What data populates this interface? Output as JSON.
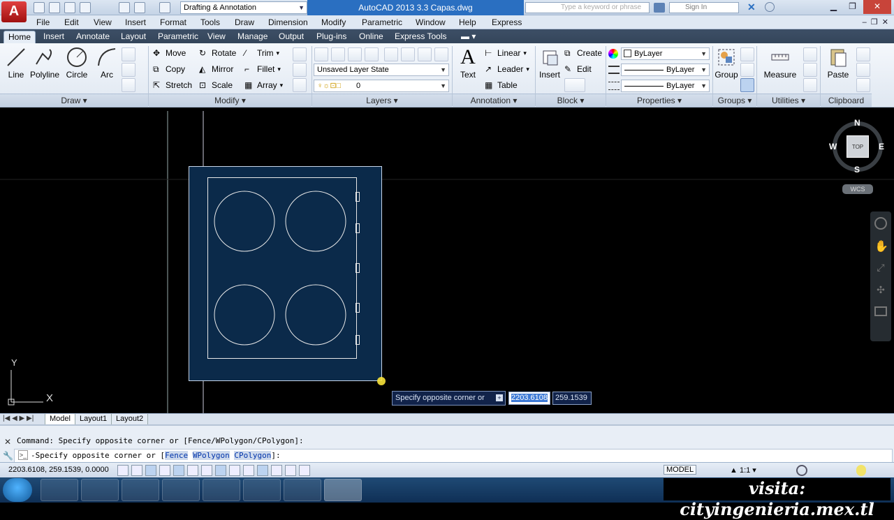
{
  "title_bar": {
    "app_button": "A",
    "workspace": "Drafting & Annotation",
    "window_title": "AutoCAD 2013    3.3 Capas.dwg",
    "search_placeholder": "Type a keyword or phrase",
    "sign_in": "Sign In"
  },
  "menu": [
    "File",
    "Edit",
    "View",
    "Insert",
    "Format",
    "Tools",
    "Draw",
    "Dimension",
    "Modify",
    "Parametric",
    "Window",
    "Help",
    "Express"
  ],
  "ribbon_tabs": [
    "Home",
    "Insert",
    "Annotate",
    "Layout",
    "Parametric",
    "View",
    "Manage",
    "Output",
    "Plug-ins",
    "Online",
    "Express Tools"
  ],
  "ribbon": {
    "draw": {
      "title": "Draw",
      "line": "Line",
      "polyline": "Polyline",
      "circle": "Circle",
      "arc": "Arc"
    },
    "modify": {
      "title": "Modify",
      "move": "Move",
      "rotate": "Rotate",
      "trim": "Trim",
      "copy": "Copy",
      "mirror": "Mirror",
      "fillet": "Fillet",
      "stretch": "Stretch",
      "scale": "Scale",
      "array": "Array"
    },
    "layers": {
      "title": "Layers",
      "layer_state": "Unsaved Layer State",
      "current_layer": "0"
    },
    "annotation": {
      "title": "Annotation",
      "text": "Text",
      "linear": "Linear",
      "leader": "Leader",
      "table": "Table"
    },
    "block": {
      "title": "Block",
      "insert": "Insert",
      "create": "Create",
      "edit": "Edit"
    },
    "properties": {
      "title": "Properties",
      "color": "ByLayer",
      "linetype": "ByLayer",
      "lineweight": "ByLayer"
    },
    "groups": {
      "title": "Groups",
      "group": "Group"
    },
    "utilities": {
      "title": "Utilities",
      "measure": "Measure"
    },
    "clipboard": {
      "title": "Clipboard",
      "paste": "Paste"
    }
  },
  "viewcube": {
    "north": "N",
    "south": "S",
    "east": "E",
    "west": "W",
    "face": "TOP",
    "wcs": "WCS"
  },
  "ucs": {
    "y": "Y",
    "x": "X"
  },
  "tooltip": {
    "prompt": "Specify opposite corner or",
    "x_value": "2203.6108",
    "y_value": "259.1539"
  },
  "layout_tabs": [
    "Model",
    "Layout1",
    "Layout2"
  ],
  "command": {
    "history": "Command: Specify opposite corner or [Fence/WPolygon/CPolygon]:",
    "prompt_prefix": "Specify opposite corner or [",
    "opt_fence": "Fence",
    "opt_wpolygon": "WPolygon",
    "opt_cpolygon": "CPolygon",
    "prompt_suffix": "]:"
  },
  "status": {
    "coords": "2203.6108, 259.1539, 0.0000",
    "model": "MODEL",
    "scale": "1:1"
  },
  "watermark": "visita: cityingenieria.mex.tl",
  "colors": {
    "accent": "#2a6fc1",
    "selection_fill": "#0b2a4a",
    "canvas": "#000000"
  }
}
